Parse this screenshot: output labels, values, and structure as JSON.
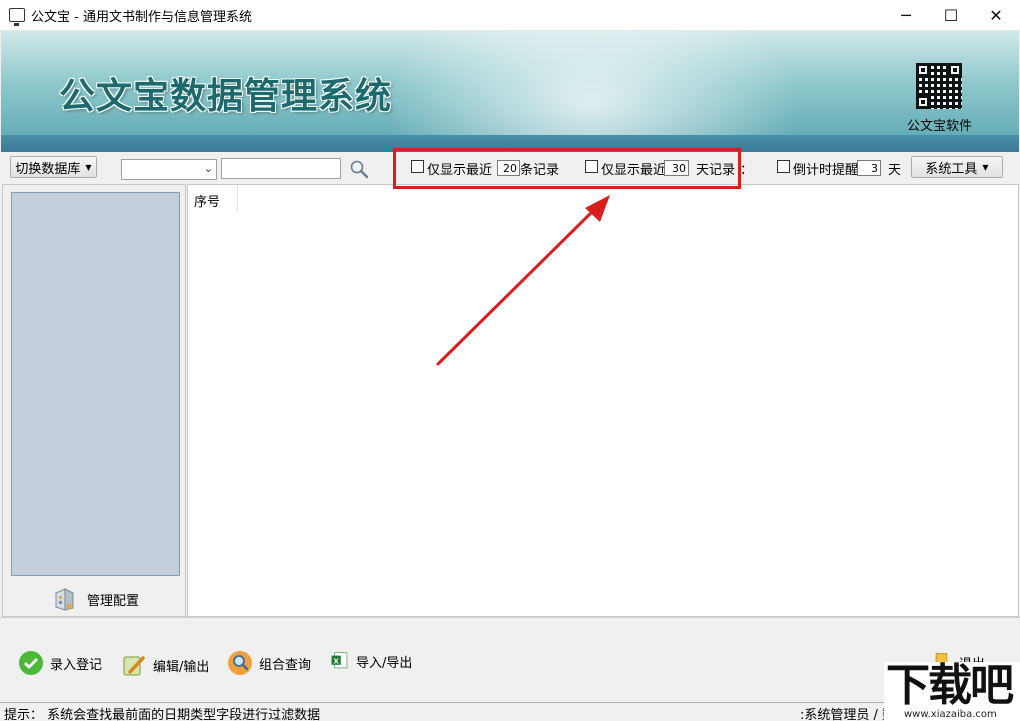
{
  "window": {
    "title": "公文宝 - 通用文书制作与信息管理系统",
    "minimize": "─",
    "maximize": "☐",
    "close": "✕"
  },
  "banner": {
    "system_title": "公文宝数据管理系统",
    "qr_label": "公文宝软件"
  },
  "toolbar": {
    "switch_db": "切换数据库",
    "combo_value": "",
    "search_value": "",
    "filter1_prefix": "仅显示最近",
    "filter1_value": "20",
    "filter1_suffix": "条记录",
    "filter2_prefix": "仅显示最近",
    "filter2_value": "30",
    "filter2_suffix": "天记录",
    "colon": "：",
    "countdown_label": "倒计时提醒",
    "countdown_value": "3",
    "countdown_unit": "天",
    "system_tools": "系统工具"
  },
  "left_panel": {
    "config_label": "管理配置"
  },
  "grid": {
    "columns": [
      "序号"
    ]
  },
  "actions": {
    "register": "录入登记",
    "edit_output": "编辑/输出",
    "combined_query": "组合查询",
    "import_export": "导入/导出",
    "exit": "退出"
  },
  "status": {
    "hint": "提示：  系统会查找最前面的日期类型字段进行过滤数据",
    "user": ":系统管理员 / 数"
  },
  "watermark": {
    "brand": "下载吧",
    "url": "www.xiazaiba.com"
  },
  "colors": {
    "highlight": "#d91e1e",
    "arrow": "#d91e1e",
    "list_bg": "#c3cfdc"
  }
}
